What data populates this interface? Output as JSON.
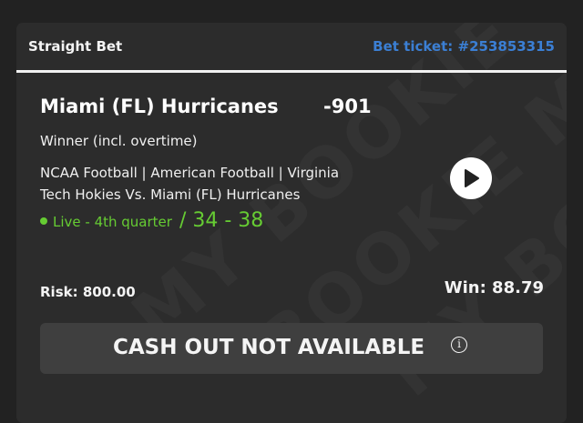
{
  "header": {
    "bet_type": "Straight Bet",
    "ticket": "Bet ticket: #253853315"
  },
  "selection": {
    "team": "Miami (FL) Hurricanes",
    "odds": "-901",
    "market": "Winner (incl. overtime)",
    "event": "NCAA Football | American Football | Virginia Tech Hokies Vs. Miami (FL) Hurricanes",
    "live_status": "Live - 4th quarter",
    "score": "/ 34 - 38"
  },
  "amounts": {
    "risk": "Risk: 800.00",
    "win": "Win: 88.79"
  },
  "cashout": {
    "label": "CASH OUT NOT AVAILABLE",
    "info_symbol": "i"
  },
  "watermark": [
    "MY BOOKIE MY",
    "BOOKIE MY BOOKIE",
    "MY BOOKIE MY"
  ],
  "icons": {
    "play": "play-icon",
    "info": "info-icon",
    "live": "live-dot-icon"
  },
  "colors": {
    "background": "#222222",
    "card": "#2c2c2c",
    "accent_blue": "#3b7fd4",
    "live_green": "#66cc33",
    "cashout_bg": "#3f3f3f"
  }
}
